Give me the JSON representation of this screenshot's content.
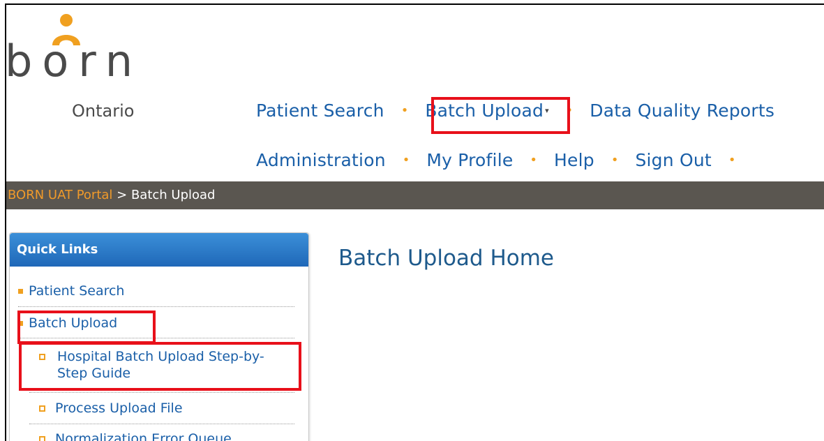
{
  "logo": {
    "word": "born",
    "sub": "Ontario"
  },
  "nav": {
    "row1": [
      "Patient Search",
      "Batch Upload",
      "Data Quality Reports"
    ],
    "row2": [
      "Administration",
      "My Profile",
      "Help",
      "Sign Out"
    ],
    "separator": "•",
    "caret": "▾"
  },
  "breadcrumb": {
    "root": "BORN UAT Portal",
    "sep": " > ",
    "current": "Batch Upload"
  },
  "quick_links": {
    "title": "Quick Links",
    "items": [
      "Patient Search",
      "Batch Upload"
    ],
    "subitems": [
      "Hospital Batch Upload Step-by-Step Guide",
      "Process Upload File",
      "Normalization Error Queue"
    ]
  },
  "main": {
    "title": "Batch Upload Home"
  },
  "colors": {
    "link": "#1a5fa8",
    "accent": "#f0a020",
    "breadcrumb_bg": "#5a5650",
    "highlight": "#e8101a"
  }
}
